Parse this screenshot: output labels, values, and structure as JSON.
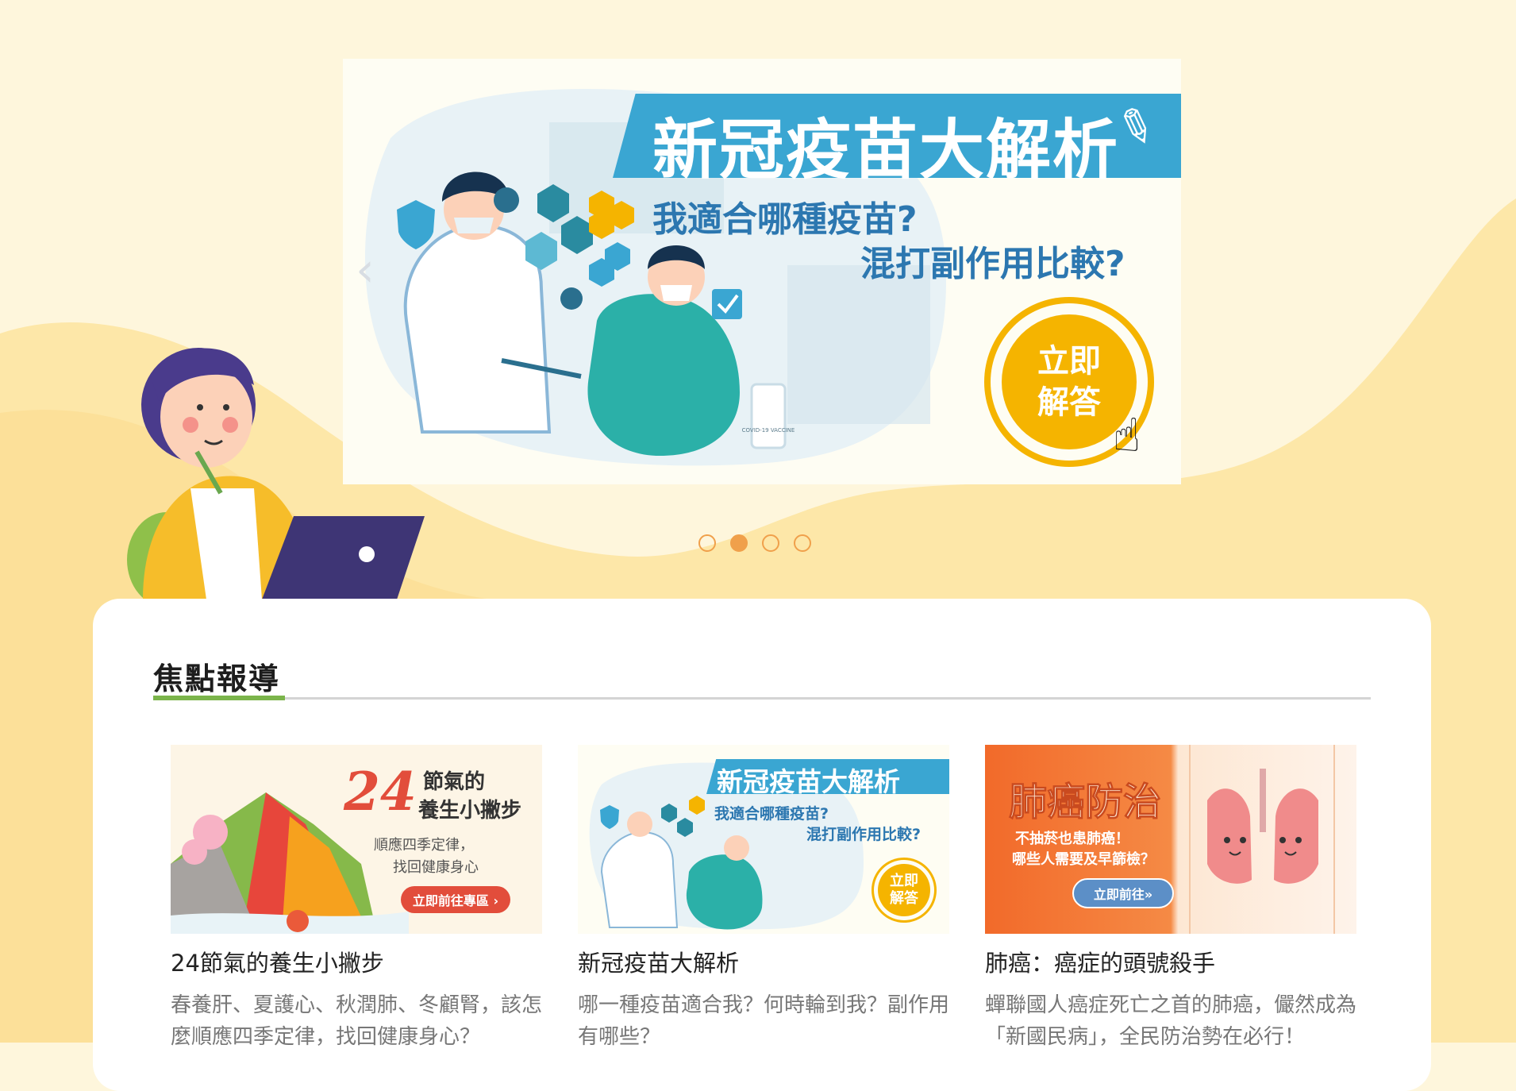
{
  "hero": {
    "title": "新冠疫苗大解析",
    "subtitle1": "我適合哪種疫苗?",
    "subtitle2": "混打副作用比較?",
    "cta": "立即解答",
    "prev_glyph": "‹",
    "vaccine_label": "COVID-19 VACCINE"
  },
  "carousel": {
    "count": 4,
    "active_index": 1
  },
  "focus": {
    "heading": "焦點報導",
    "cards": [
      {
        "title": "24節氣的養生小撇步",
        "desc": "春養肝、夏護心、秋潤肺、冬顧腎，該怎麼順應四季定律，找回健康身心？",
        "thumb": {
          "big_number": "24",
          "line1": "節氣的",
          "line2": "養生小撇步",
          "line3": "順應四季定律，",
          "line4": "找回健康身心",
          "button": "立即前往專區 ›"
        }
      },
      {
        "title": "新冠疫苗大解析",
        "desc": "哪一種疫苗適合我？何時輪到我？副作用有哪些？",
        "thumb": {
          "heading": "新冠疫苗大解析",
          "line1": "我適合哪種疫苗?",
          "line2": "混打副作用比較?",
          "button": "立即解答"
        }
      },
      {
        "title": "肺癌：癌症的頭號殺手",
        "desc": "蟬聯國人癌症死亡之首的肺癌，儼然成為「新國民病」，全民防治勢在必行！",
        "thumb": {
          "heading": "肺癌防治",
          "line1": "不抽菸也患肺癌！",
          "line2": "哪些人需要及早篩檢？",
          "button": "立即前往»"
        }
      }
    ]
  },
  "colors": {
    "page_bg": "#fef6dc",
    "wave": "#fde7a8",
    "accent_green": "#7bb44b",
    "carousel_dot": "#f0a04b",
    "hero_blue": "#3aa6d2",
    "cta_yellow": "#f5b400",
    "lung_orange": "#f0782f"
  }
}
